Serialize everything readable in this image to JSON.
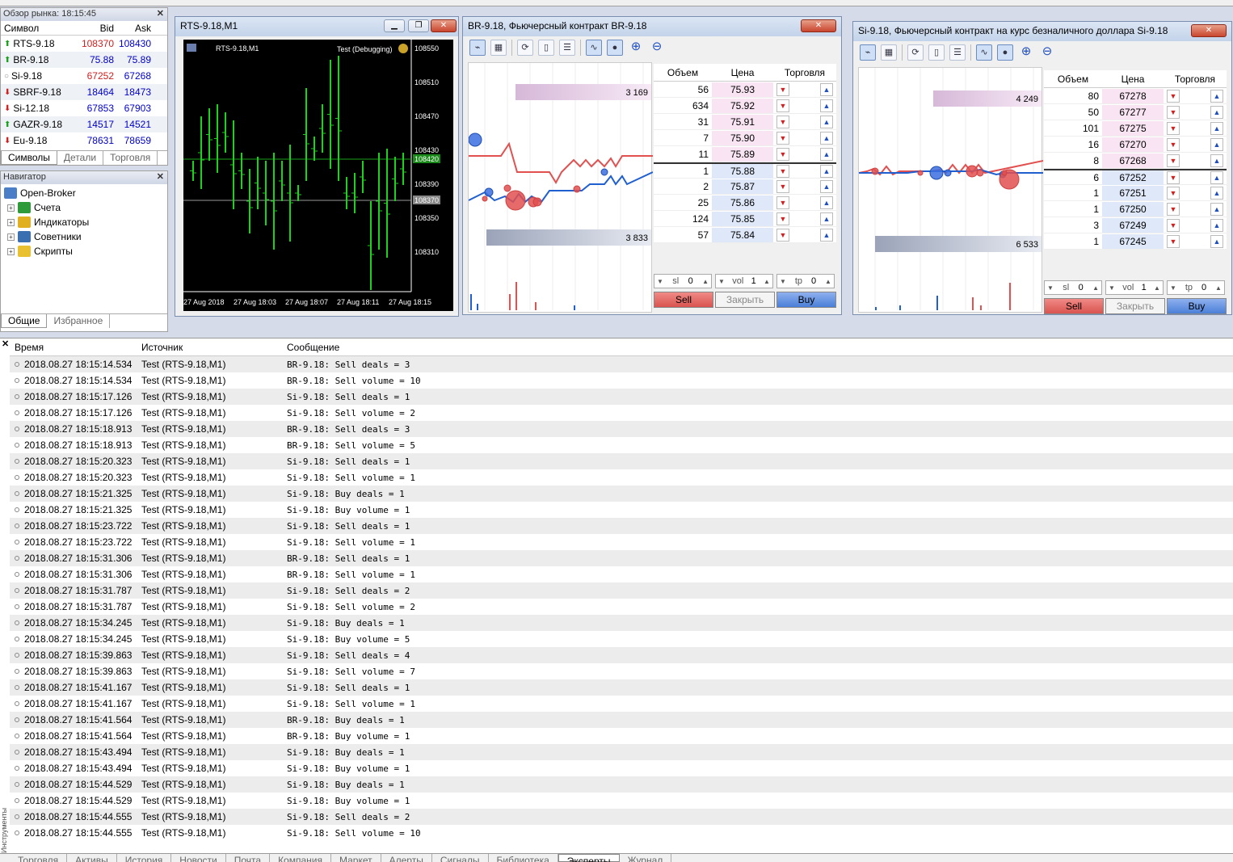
{
  "market_watch": {
    "title": "Обзор рынка: 18:15:45",
    "headers": {
      "symbol": "Символ",
      "bid": "Bid",
      "ask": "Ask"
    },
    "rows": [
      {
        "symbol": "RTS-9.18",
        "bid": "108370",
        "ask": "108430",
        "dir": "up",
        "bid_color": "#d02020"
      },
      {
        "symbol": "BR-9.18",
        "bid": "75.88",
        "ask": "75.89",
        "dir": "up",
        "bid_color": "#0000c8"
      },
      {
        "symbol": "Si-9.18",
        "bid": "67252",
        "ask": "67268",
        "dir": "none",
        "bid_color": "#d02020"
      },
      {
        "symbol": "SBRF-9.18",
        "bid": "18464",
        "ask": "18473",
        "dir": "down",
        "bid_color": "#0000c8"
      },
      {
        "symbol": "Si-12.18",
        "bid": "67853",
        "ask": "67903",
        "dir": "down",
        "bid_color": "#0000c8"
      },
      {
        "symbol": "GAZR-9.18",
        "bid": "14517",
        "ask": "14521",
        "dir": "up",
        "bid_color": "#0000c8"
      },
      {
        "symbol": "Eu-9.18",
        "bid": "78631",
        "ask": "78659",
        "dir": "down",
        "bid_color": "#0000c8"
      }
    ],
    "tabs": [
      "Символы",
      "Детали",
      "Торговля"
    ]
  },
  "navigator": {
    "title": "Навигатор",
    "root": "Open-Broker",
    "items": [
      "Счета",
      "Индикаторы",
      "Советники",
      "Скрипты"
    ],
    "tabs": [
      "Общие",
      "Избранное"
    ]
  },
  "rts_window": {
    "title": "RTS-9.18,M1",
    "chart_label": "RTS-9.18,M1",
    "expert_label": "Test (Debugging)",
    "price_labels": [
      "108550",
      "108510",
      "108470",
      "108430",
      "108420",
      "108390",
      "108370",
      "108350",
      "108310"
    ],
    "time_labels": [
      "27 Aug 2018",
      "27 Aug 18:03",
      "27 Aug 18:07",
      "27 Aug 18:11",
      "27 Aug 18:15"
    ]
  },
  "br_window": {
    "title": "BR-9.18, Фьючерсный контракт BR-9.18",
    "headers": {
      "volume": "Объем",
      "price": "Цена",
      "trade": "Торговля"
    },
    "ask_total": "3 169",
    "bid_total": "3 833",
    "rows": [
      {
        "vol": "56",
        "price": "75.93",
        "side": "ask"
      },
      {
        "vol": "634",
        "price": "75.92",
        "side": "ask"
      },
      {
        "vol": "31",
        "price": "75.91",
        "side": "ask"
      },
      {
        "vol": "7",
        "price": "75.90",
        "side": "ask"
      },
      {
        "vol": "11",
        "price": "75.89",
        "side": "ask"
      },
      {
        "vol": "1",
        "price": "75.88",
        "side": "bid"
      },
      {
        "vol": "2",
        "price": "75.87",
        "side": "bid"
      },
      {
        "vol": "25",
        "price": "75.86",
        "side": "bid"
      },
      {
        "vol": "124",
        "price": "75.85",
        "side": "bid"
      },
      {
        "vol": "57",
        "price": "75.84",
        "side": "bid"
      }
    ],
    "sl_label": "sl",
    "sl_value": "0",
    "vol_label": "vol",
    "vol_value": "1",
    "tp_label": "tp",
    "tp_value": "0",
    "sell": "Sell",
    "close": "Закрыть",
    "buy": "Buy"
  },
  "si_window": {
    "title": "Si-9.18, Фьючерсный контракт на курс безналичного доллара Si-9.18",
    "headers": {
      "volume": "Объем",
      "price": "Цена",
      "trade": "Торговля"
    },
    "ask_total": "4 249",
    "bid_total": "6 533",
    "rows": [
      {
        "vol": "80",
        "price": "67278",
        "side": "ask"
      },
      {
        "vol": "50",
        "price": "67277",
        "side": "ask"
      },
      {
        "vol": "101",
        "price": "67275",
        "side": "ask"
      },
      {
        "vol": "16",
        "price": "67270",
        "side": "ask"
      },
      {
        "vol": "8",
        "price": "67268",
        "side": "ask"
      },
      {
        "vol": "6",
        "price": "67252",
        "side": "bid"
      },
      {
        "vol": "1",
        "price": "67251",
        "side": "bid"
      },
      {
        "vol": "1",
        "price": "67250",
        "side": "bid"
      },
      {
        "vol": "3",
        "price": "67249",
        "side": "bid"
      },
      {
        "vol": "1",
        "price": "67245",
        "side": "bid"
      }
    ],
    "sl_label": "sl",
    "sl_value": "0",
    "vol_label": "vol",
    "vol_value": "1",
    "tp_label": "tp",
    "tp_value": "0",
    "sell": "Sell",
    "close": "Закрыть",
    "buy": "Buy"
  },
  "log": {
    "headers": {
      "time": "Время",
      "source": "Источник",
      "message": "Сообщение"
    },
    "rows": [
      {
        "time": "2018.08.27 18:15:14.534",
        "source": "Test (RTS-9.18,M1)",
        "message": "BR-9.18: Sell deals = 3"
      },
      {
        "time": "2018.08.27 18:15:14.534",
        "source": "Test (RTS-9.18,M1)",
        "message": "BR-9.18: Sell volume = 10"
      },
      {
        "time": "2018.08.27 18:15:17.126",
        "source": "Test (RTS-9.18,M1)",
        "message": "Si-9.18: Sell deals = 1"
      },
      {
        "time": "2018.08.27 18:15:17.126",
        "source": "Test (RTS-9.18,M1)",
        "message": "Si-9.18: Sell volume = 2"
      },
      {
        "time": "2018.08.27 18:15:18.913",
        "source": "Test (RTS-9.18,M1)",
        "message": "BR-9.18: Sell deals = 3"
      },
      {
        "time": "2018.08.27 18:15:18.913",
        "source": "Test (RTS-9.18,M1)",
        "message": "BR-9.18: Sell volume = 5"
      },
      {
        "time": "2018.08.27 18:15:20.323",
        "source": "Test (RTS-9.18,M1)",
        "message": "Si-9.18: Sell deals = 1"
      },
      {
        "time": "2018.08.27 18:15:20.323",
        "source": "Test (RTS-9.18,M1)",
        "message": "Si-9.18: Sell volume = 1"
      },
      {
        "time": "2018.08.27 18:15:21.325",
        "source": "Test (RTS-9.18,M1)",
        "message": "Si-9.18: Buy deals = 1"
      },
      {
        "time": "2018.08.27 18:15:21.325",
        "source": "Test (RTS-9.18,M1)",
        "message": "Si-9.18: Buy volume = 1"
      },
      {
        "time": "2018.08.27 18:15:23.722",
        "source": "Test (RTS-9.18,M1)",
        "message": "Si-9.18: Sell deals = 1"
      },
      {
        "time": "2018.08.27 18:15:23.722",
        "source": "Test (RTS-9.18,M1)",
        "message": "Si-9.18: Sell volume = 1"
      },
      {
        "time": "2018.08.27 18:15:31.306",
        "source": "Test (RTS-9.18,M1)",
        "message": "BR-9.18: Sell deals = 1"
      },
      {
        "time": "2018.08.27 18:15:31.306",
        "source": "Test (RTS-9.18,M1)",
        "message": "BR-9.18: Sell volume = 1"
      },
      {
        "time": "2018.08.27 18:15:31.787",
        "source": "Test (RTS-9.18,M1)",
        "message": "Si-9.18: Sell deals = 2"
      },
      {
        "time": "2018.08.27 18:15:31.787",
        "source": "Test (RTS-9.18,M1)",
        "message": "Si-9.18: Sell volume = 2"
      },
      {
        "time": "2018.08.27 18:15:34.245",
        "source": "Test (RTS-9.18,M1)",
        "message": "Si-9.18: Buy deals = 1"
      },
      {
        "time": "2018.08.27 18:15:34.245",
        "source": "Test (RTS-9.18,M1)",
        "message": "Si-9.18: Buy volume = 5"
      },
      {
        "time": "2018.08.27 18:15:39.863",
        "source": "Test (RTS-9.18,M1)",
        "message": "Si-9.18: Sell deals = 4"
      },
      {
        "time": "2018.08.27 18:15:39.863",
        "source": "Test (RTS-9.18,M1)",
        "message": "Si-9.18: Sell volume = 7"
      },
      {
        "time": "2018.08.27 18:15:41.167",
        "source": "Test (RTS-9.18,M1)",
        "message": "Si-9.18: Sell deals = 1"
      },
      {
        "time": "2018.08.27 18:15:41.167",
        "source": "Test (RTS-9.18,M1)",
        "message": "Si-9.18: Sell volume = 1"
      },
      {
        "time": "2018.08.27 18:15:41.564",
        "source": "Test (RTS-9.18,M1)",
        "message": "BR-9.18: Buy deals = 1"
      },
      {
        "time": "2018.08.27 18:15:41.564",
        "source": "Test (RTS-9.18,M1)",
        "message": "BR-9.18: Buy volume = 1"
      },
      {
        "time": "2018.08.27 18:15:43.494",
        "source": "Test (RTS-9.18,M1)",
        "message": "Si-9.18: Buy deals = 1"
      },
      {
        "time": "2018.08.27 18:15:43.494",
        "source": "Test (RTS-9.18,M1)",
        "message": "Si-9.18: Buy volume = 1"
      },
      {
        "time": "2018.08.27 18:15:44.529",
        "source": "Test (RTS-9.18,M1)",
        "message": "Si-9.18: Buy deals = 1"
      },
      {
        "time": "2018.08.27 18:15:44.529",
        "source": "Test (RTS-9.18,M1)",
        "message": "Si-9.18: Buy volume = 1"
      },
      {
        "time": "2018.08.27 18:15:44.555",
        "source": "Test (RTS-9.18,M1)",
        "message": "Si-9.18: Sell deals = 2"
      },
      {
        "time": "2018.08.27 18:15:44.555",
        "source": "Test (RTS-9.18,M1)",
        "message": "Si-9.18: Sell volume = 10"
      }
    ]
  },
  "bottom_tabs": [
    "Торговля",
    "Активы",
    "История",
    "Новости",
    "Почта",
    "Компания",
    "Маркет",
    "Алерты",
    "Сигналы",
    "Библиотека",
    "Эксперты",
    "Журнал"
  ],
  "bottom_tabs_active": "Эксперты",
  "toolbox_label": "Инструменты"
}
